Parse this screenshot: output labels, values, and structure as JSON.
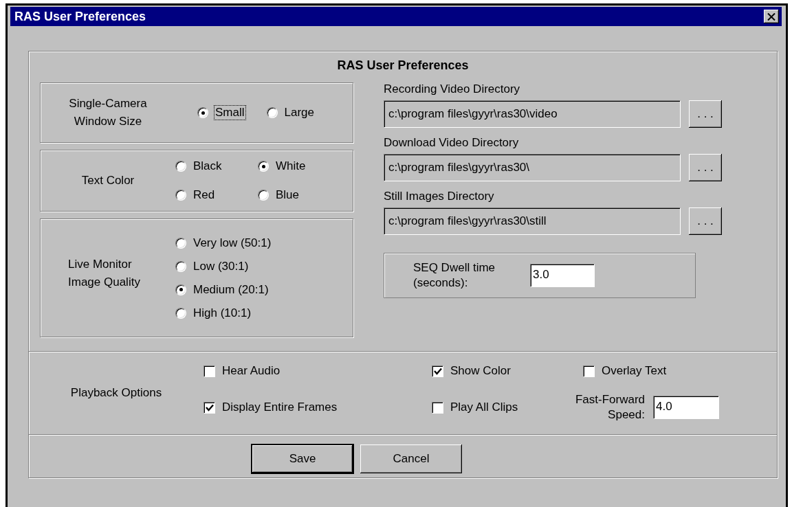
{
  "window": {
    "title": "RAS User Preferences"
  },
  "heading": "RAS User Preferences",
  "window_size": {
    "label": "Single-Camera Window Size",
    "options": [
      {
        "label": "Small",
        "selected": true,
        "focused": true
      },
      {
        "label": "Large",
        "selected": false,
        "focused": false
      }
    ]
  },
  "text_color": {
    "label": "Text Color",
    "options": [
      {
        "label": "Black",
        "selected": false
      },
      {
        "label": "White",
        "selected": true
      },
      {
        "label": "Red",
        "selected": false
      },
      {
        "label": "Blue",
        "selected": false
      }
    ]
  },
  "image_quality": {
    "label": "Live Monitor Image Quality",
    "options": [
      {
        "label": "Very low (50:1)",
        "selected": false
      },
      {
        "label": "Low (30:1)",
        "selected": false
      },
      {
        "label": "Medium (20:1)",
        "selected": true
      },
      {
        "label": "High (10:1)",
        "selected": false
      }
    ]
  },
  "directories": [
    {
      "label": "Recording Video Directory",
      "value": "c:\\program files\\gyyr\\ras30\\video",
      "browse": ". . ."
    },
    {
      "label": "Download Video Directory",
      "value": "c:\\program files\\gyyr\\ras30\\",
      "browse": ". . ."
    },
    {
      "label": "Still Images Directory",
      "value": "c:\\program files\\gyyr\\ras30\\still",
      "browse": ". . ."
    }
  ],
  "dwell": {
    "label": "SEQ Dwell time (seconds):",
    "value": "3.0"
  },
  "playback": {
    "label": "Playback Options",
    "options": [
      {
        "label": "Hear Audio",
        "checked": false
      },
      {
        "label": "Show Color",
        "checked": true
      },
      {
        "label": "Overlay Text",
        "checked": false
      },
      {
        "label": "Display Entire Frames",
        "checked": true
      },
      {
        "label": "Play All Clips",
        "checked": false
      }
    ],
    "fast_forward": {
      "label": "Fast-Forward Speed:",
      "value": "4.0"
    }
  },
  "buttons": [
    {
      "label": "Save",
      "default": true
    },
    {
      "label": "Cancel",
      "default": false
    }
  ]
}
